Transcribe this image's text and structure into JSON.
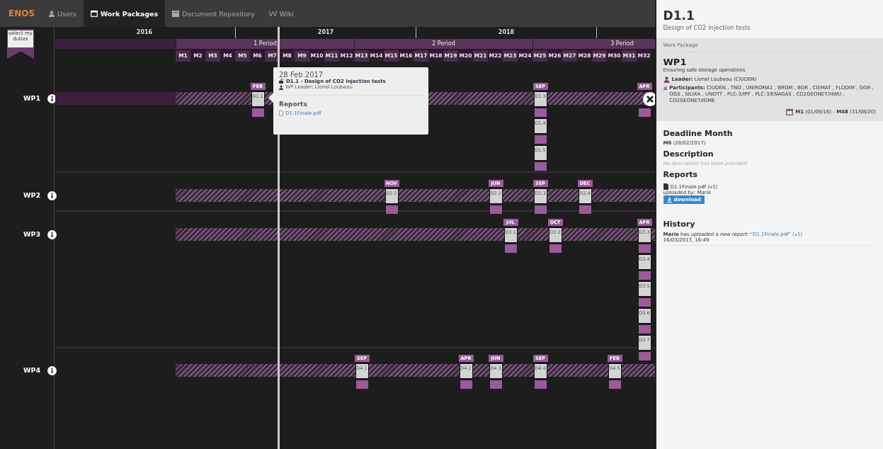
{
  "nav": {
    "brand": "ENOS",
    "tabs": [
      {
        "label": "Users",
        "selected": false
      },
      {
        "label": "Work Packages",
        "selected": true
      },
      {
        "label": "Document Repository",
        "selected": false
      },
      {
        "label": "Wiki",
        "selected": false
      }
    ]
  },
  "duties_ribbon": "select my duties",
  "timeline": {
    "years": [
      "2016",
      "2017",
      "2018"
    ],
    "periods": [
      "1 Period",
      "2 Period",
      "3 Period"
    ],
    "months": [
      "M1",
      "M2",
      "M3",
      "M4",
      "M5",
      "M6",
      "M7",
      "M8",
      "M9",
      "M10",
      "M11",
      "M12",
      "M13",
      "M14",
      "M15",
      "M16",
      "M17",
      "M18",
      "M19",
      "M20",
      "M21",
      "M22",
      "M23",
      "M24",
      "M25",
      "M26",
      "M27",
      "M28",
      "M29",
      "M30",
      "M31",
      "M32"
    ]
  },
  "work_packages": [
    {
      "name": "WP1",
      "selected": true,
      "milestones": [
        {
          "month": "FEB",
          "items": [
            "D1.1"
          ]
        },
        {
          "month": "SEP",
          "items": [
            "D1.3",
            "D1.4",
            "D1.5"
          ]
        },
        {
          "month": "APR"
        }
      ]
    },
    {
      "name": "WP2",
      "selected": false,
      "milestones": [
        {
          "month": "NOV",
          "items": [
            "D2.1"
          ]
        },
        {
          "month": "JUN",
          "items": [
            "D2.2"
          ]
        },
        {
          "month": "SEP",
          "items": [
            "D2.3"
          ]
        },
        {
          "month": "DEC",
          "items": [
            "D2.4"
          ]
        }
      ]
    },
    {
      "name": "WP3",
      "selected": false,
      "milestones": [
        {
          "month": "JUL",
          "items": [
            "D3.1"
          ]
        },
        {
          "month": "OCT",
          "items": [
            "D3.2"
          ]
        },
        {
          "month": "APR",
          "items": [
            "D3.3",
            "D3.4",
            "D3.5",
            "D3.6",
            "D3.7"
          ]
        }
      ]
    },
    {
      "name": "WP4",
      "selected": false,
      "milestones": [
        {
          "month": "SEP",
          "items": [
            "D4.1"
          ]
        },
        {
          "month": "APR",
          "items": [
            "D4.2"
          ]
        },
        {
          "month": "JUN",
          "items": [
            "D4.3"
          ]
        },
        {
          "month": "SEP",
          "items": [
            "D4.4"
          ]
        },
        {
          "month": "FEB",
          "items": [
            "D4.5"
          ]
        }
      ]
    }
  ],
  "tooltip": {
    "date": "28 Feb 2017",
    "title": "D1.1 - Design of CO2 injection tests",
    "leader": "WP Leader: Lionel Loubeau",
    "reports_heading": "Reports",
    "report_link": "D1.1Finale.pdf"
  },
  "panel": {
    "title": "D1.1",
    "subtitle": "Design of CO2 injection tests",
    "work_package": {
      "caption": "Work Package",
      "name": "WP1",
      "description": "Ensuring safe storage operations",
      "leader": "**Leader:** Lionel Loubeau (CIUDEN)",
      "participants": "**Participants:** CIUDEN , TNO , UNIROMA1 , BRGM , BGR , CIEMAT , FLODIM , GGR , OGS , SILIXA , UNOTT , PLC-3/IPF , PLC-3/ENAGAS , CO2GEONET/HWU , CO2GEONET/IGME",
      "dates": "**M1** (01/09/16) - **M48** (31/08/20)"
    },
    "deadline_heading": "Deadline Month",
    "deadline": "**M6** (28/02/2017)",
    "description_heading": "Description",
    "description": "No description has been provided.",
    "reports_heading": "Reports",
    "report_file": "D1.1Finale.pdf (v1)",
    "uploaded_by": "uploaded by: Marie",
    "download_button": "download",
    "history_heading": "History",
    "history": [
      {
        "text": "**Marie** has *uploaded a new report*: ",
        "link": "\"D1.1Finale.pdf\" (v1)",
        "time": "16/03/2017, 16:49"
      }
    ]
  }
}
